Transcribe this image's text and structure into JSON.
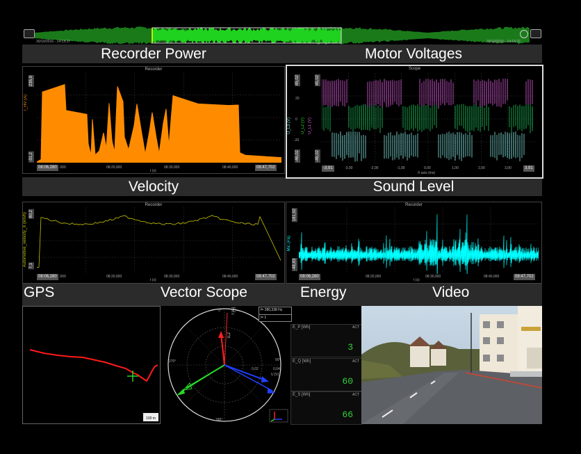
{
  "colors": {
    "power": "#ff8c00",
    "velocity": "#c8c400",
    "sound": "#00ffff",
    "overview": "#1fd21f",
    "gps_track": "#ff1a1a",
    "gps_marker": "#2ad52a",
    "meter_value": "#36d13a"
  },
  "overview": {
    "start_time": "30/10/2016 - 14:13:37",
    "end_time": "30/10/2016 - 14:15:22",
    "left_icon": "film-icon",
    "right_icon": "clock-icon",
    "far_right_icon": "film-icon"
  },
  "sections": {
    "recorder_power": "Recorder Power",
    "motor_voltages": "Motor Voltages",
    "velocity": "Velocity",
    "sound_level": "Sound Level",
    "gps": "GPS",
    "vector_scope": "Vector Scope",
    "energy": "Energy",
    "video": "Video"
  },
  "power_panel": {
    "title": "Recorder",
    "ylabel": "I_HV (A)",
    "ymax": "235,9",
    "ymin": "-31,2",
    "xticks": [
      ".000",
      "08:20,000",
      "08:30,000",
      "08:40,000"
    ],
    "x_start": "08:06,280",
    "x_end": "08:47,702",
    "xlabel": "t (s)"
  },
  "scope_panel": {
    "title": "Scope",
    "ylabels": [
      "U_L3 (V)",
      "U_L2 (V)",
      "U_L1 (V)"
    ],
    "ymax": "45,02",
    "ymin": "-46,02",
    "ymid": [
      "20",
      "0",
      "-20"
    ],
    "xticks": [
      "-3,00",
      "-2,00",
      "-1,00",
      "0,00",
      "1,00",
      "2,00",
      "3,00"
    ],
    "x_start": "-3,91",
    "x_end": "3,91",
    "xlabel": "X axis (ms)"
  },
  "velocity_panel": {
    "title": "Recorder",
    "ylabel": "Automotive_velocity_X (km/h)",
    "ymax": "80,2",
    "ymin": "7,1",
    "xticks": [
      ".000",
      "08:20,000",
      "08:30,000",
      "08:40,000"
    ],
    "x_start": "08:06,280",
    "x_end": "08:47,702",
    "xlabel": "t (s)"
  },
  "sound_panel": {
    "title": "Recorder",
    "ylabel": "Mic (Pa)",
    "ymax": "181,92",
    "ymin": "-48,83",
    "xticks": [
      "08:20,000",
      "08:30,000",
      "08:40,000"
    ],
    "x_start": "08:06,280",
    "x_end": "08:47,702",
    "xlabel": "t (s)"
  },
  "gps": {
    "scale": "100 m"
  },
  "vector_scope": {
    "frequency": "f= 280,338 Hz",
    "order": "i= 1",
    "angle_0": "0°",
    "angle_90": "90°",
    "angle_180": "180°",
    "angle_270": "270°",
    "i_label": "I [A]",
    "u_label": "U [V]",
    "i_scale": "0,2",
    "u_scale_1": "0,02",
    "u_scale_2": "0,04"
  },
  "energy": [
    {
      "name": "E_P [Wh]",
      "act": "ACT",
      "value": "3"
    },
    {
      "name": "E_Q [Wh]",
      "act": "ACT",
      "value": "60"
    },
    {
      "name": "E_S [Wh]",
      "act": "ACT",
      "value": "66"
    }
  ]
}
